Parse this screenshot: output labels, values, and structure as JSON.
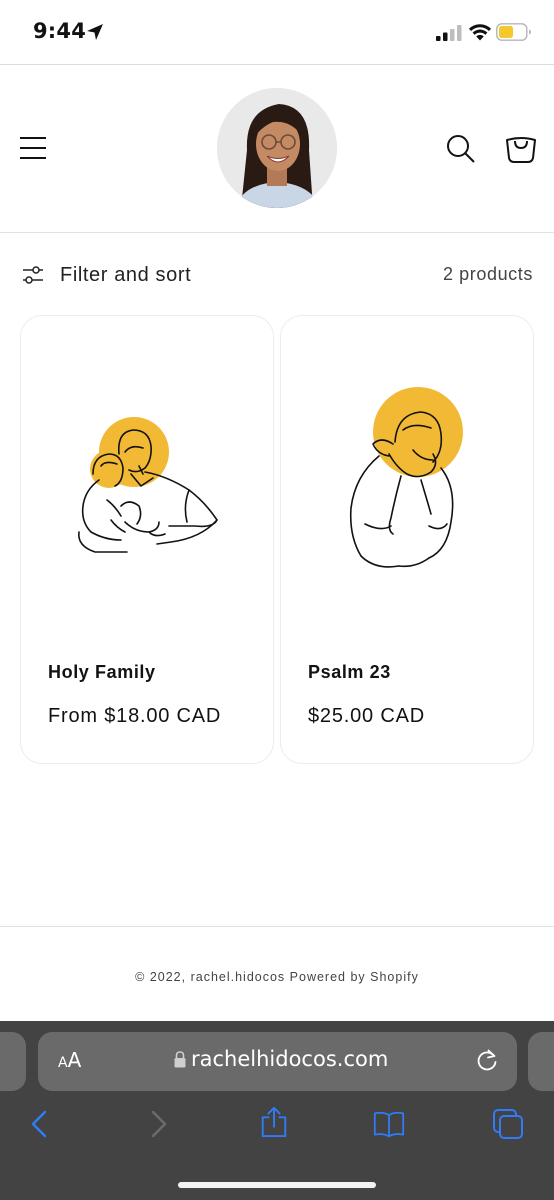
{
  "status_bar": {
    "time": "9:44",
    "battery_color": "#f5c82e"
  },
  "header": {
    "avatar_alt": "rachel.hidocos",
    "icons": [
      "menu-icon",
      "search-icon",
      "cart-icon"
    ]
  },
  "filter": {
    "label": "Filter and sort",
    "count": "2 products"
  },
  "products": [
    {
      "title": "Holy Family",
      "price": "From $18.00 CAD",
      "art": "holy-family-illustration"
    },
    {
      "title": "Psalm 23",
      "price": "$25.00 CAD",
      "art": "psalm-23-illustration"
    }
  ],
  "colors": {
    "halo": "#f2b935",
    "text": "#121212",
    "safari_toolbar": "#434343",
    "safari_icons": "#2f7cf6"
  },
  "footer": {
    "text": "© 2022, rachel.hidocos Powered by Shopify"
  },
  "browser": {
    "aa_label_small": "A",
    "aa_label_big": "A",
    "url": "rachelhidocos.com"
  }
}
